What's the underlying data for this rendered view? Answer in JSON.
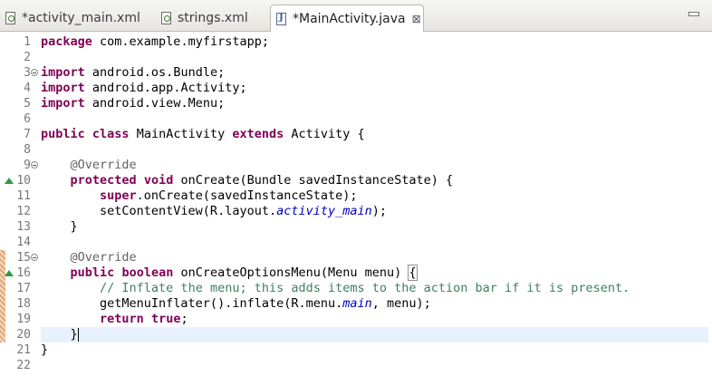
{
  "tabs": [
    {
      "label": "*activity_main.xml",
      "icon": "xml-file-icon",
      "active": false
    },
    {
      "label": "strings.xml",
      "icon": "xml-file-icon",
      "active": false
    },
    {
      "label": "*MainActivity.java",
      "icon": "java-file-icon",
      "active": true,
      "close": "⊠"
    }
  ],
  "editor": {
    "lines": [
      {
        "n": "1",
        "tokens": [
          {
            "t": "package",
            "c": "kw"
          },
          {
            "t": " com.example.myfirstapp;"
          }
        ]
      },
      {
        "n": "2",
        "tokens": []
      },
      {
        "n": "3",
        "marker": "fold",
        "tokens": [
          {
            "t": "import",
            "c": "kw"
          },
          {
            "t": " android.os.Bundle;"
          }
        ]
      },
      {
        "n": "4",
        "tokens": [
          {
            "t": "import",
            "c": "kw"
          },
          {
            "t": " android.app.Activity;"
          }
        ]
      },
      {
        "n": "5",
        "tokens": [
          {
            "t": "import",
            "c": "kw"
          },
          {
            "t": " android.view.Menu;"
          }
        ]
      },
      {
        "n": "6",
        "tokens": []
      },
      {
        "n": "7",
        "tokens": [
          {
            "t": "public",
            "c": "kw"
          },
          {
            "t": " "
          },
          {
            "t": "class",
            "c": "kw"
          },
          {
            "t": " MainActivity "
          },
          {
            "t": "extends",
            "c": "kw"
          },
          {
            "t": " Activity {"
          }
        ]
      },
      {
        "n": "8",
        "tokens": []
      },
      {
        "n": "9",
        "marker": "fold",
        "tokens": [
          {
            "t": "    "
          },
          {
            "t": "@Override",
            "c": "ann"
          }
        ]
      },
      {
        "n": "10",
        "marker": "override",
        "tokens": [
          {
            "t": "    "
          },
          {
            "t": "protected",
            "c": "kw"
          },
          {
            "t": " "
          },
          {
            "t": "void",
            "c": "kw"
          },
          {
            "t": " onCreate(Bundle savedInstanceState) {"
          }
        ]
      },
      {
        "n": "11",
        "tokens": [
          {
            "t": "        "
          },
          {
            "t": "super",
            "c": "kw"
          },
          {
            "t": ".onCreate(savedInstanceState);"
          }
        ]
      },
      {
        "n": "12",
        "tokens": [
          {
            "t": "        setContentView(R.layout."
          },
          {
            "t": "activity_main",
            "c": "fld"
          },
          {
            "t": ");"
          }
        ]
      },
      {
        "n": "13",
        "tokens": [
          {
            "t": "    }"
          }
        ]
      },
      {
        "n": "14",
        "tokens": []
      },
      {
        "n": "15",
        "marker": "fold",
        "changed": true,
        "tokens": [
          {
            "t": "    "
          },
          {
            "t": "@Override",
            "c": "ann"
          }
        ]
      },
      {
        "n": "16",
        "marker": "override",
        "changed": true,
        "tokens": [
          {
            "t": "    "
          },
          {
            "t": "public",
            "c": "kw"
          },
          {
            "t": " "
          },
          {
            "t": "boolean",
            "c": "kw"
          },
          {
            "t": " onCreateOptionsMenu(Menu menu) "
          },
          {
            "t": "{",
            "c": "bracket"
          }
        ]
      },
      {
        "n": "17",
        "changed": true,
        "tokens": [
          {
            "t": "        "
          },
          {
            "t": "// Inflate the menu; this adds items to the action bar if it is present.",
            "c": "cmt"
          }
        ]
      },
      {
        "n": "18",
        "changed": true,
        "tokens": [
          {
            "t": "        getMenuInflater().inflate(R.menu."
          },
          {
            "t": "main",
            "c": "fld"
          },
          {
            "t": ", menu);"
          }
        ]
      },
      {
        "n": "19",
        "changed": true,
        "tokens": [
          {
            "t": "        "
          },
          {
            "t": "return",
            "c": "kw"
          },
          {
            "t": " "
          },
          {
            "t": "true",
            "c": "kw"
          },
          {
            "t": ";"
          }
        ]
      },
      {
        "n": "20",
        "changed": true,
        "current": true,
        "caret": true,
        "tokens": [
          {
            "t": "    }"
          }
        ]
      },
      {
        "n": "21",
        "tokens": [
          {
            "t": "}"
          }
        ]
      },
      {
        "n": "22",
        "tokens": []
      }
    ]
  }
}
